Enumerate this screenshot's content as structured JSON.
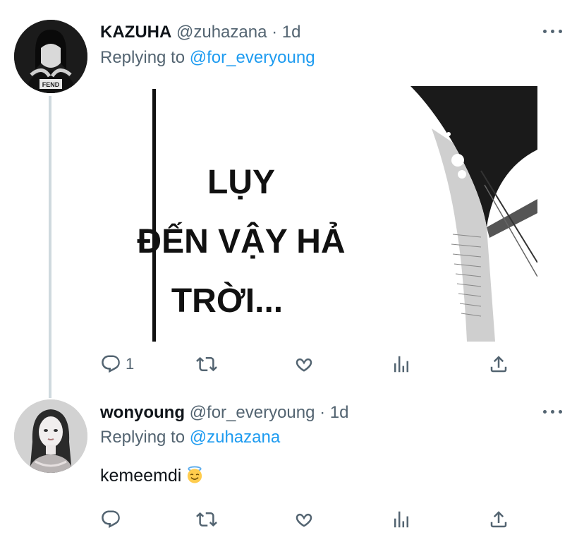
{
  "tweets": [
    {
      "display_name": "KAZUHA",
      "handle": "@zuhazana",
      "separator": "·",
      "time": "1d",
      "replying_prefix": "Replying to",
      "replying_to": "@for_everyoung",
      "media_text": [
        "LỤY",
        "ĐẾN VẬY HẢ",
        "TRỜI..."
      ],
      "actions": {
        "reply_count": "1",
        "retweet_count": "",
        "like_count": ""
      }
    },
    {
      "display_name": "wonyoung",
      "handle": "@for_everyoung",
      "separator": "·",
      "time": "1d",
      "replying_prefix": "Replying to",
      "replying_to": "@zuhazana",
      "text": "kemeemdi",
      "emoji": "smiling-face-with-halo-icon",
      "actions": {
        "reply_count": "",
        "retweet_count": "",
        "like_count": ""
      }
    }
  ],
  "colors": {
    "text": "#0f1419",
    "secondary": "#536471",
    "accent": "#1d9bf0",
    "thread_line": "#cfd9de"
  }
}
